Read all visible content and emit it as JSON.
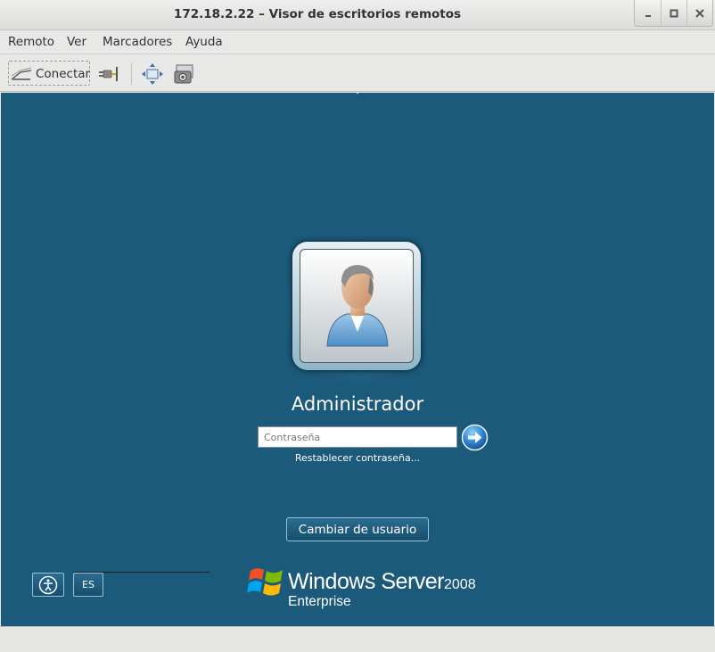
{
  "window": {
    "title": "172.18.2.22 – Visor de escritorios remotos",
    "controls": [
      "minimize-icon",
      "maximize-icon",
      "close-icon"
    ]
  },
  "menubar": {
    "items": [
      "Remoto",
      "Ver",
      "Marcadores",
      "Ayuda"
    ]
  },
  "toolbar": {
    "connect_label": "Conectar",
    "icons": [
      "connect-icon",
      "disconnect-plug-icon",
      "fullscreen-icon",
      "screenshot-icon"
    ]
  },
  "remote": {
    "background_color": "#1c5a7b",
    "user_name": "Administrador",
    "password_placeholder": "Contraseña",
    "reset_link": "Restablecer contraseña...",
    "switch_user_button": "Cambiar de usuario",
    "language_button": "ES",
    "brand": {
      "product": "Windows Server",
      "version": "2008",
      "edition": "Enterprise"
    }
  }
}
